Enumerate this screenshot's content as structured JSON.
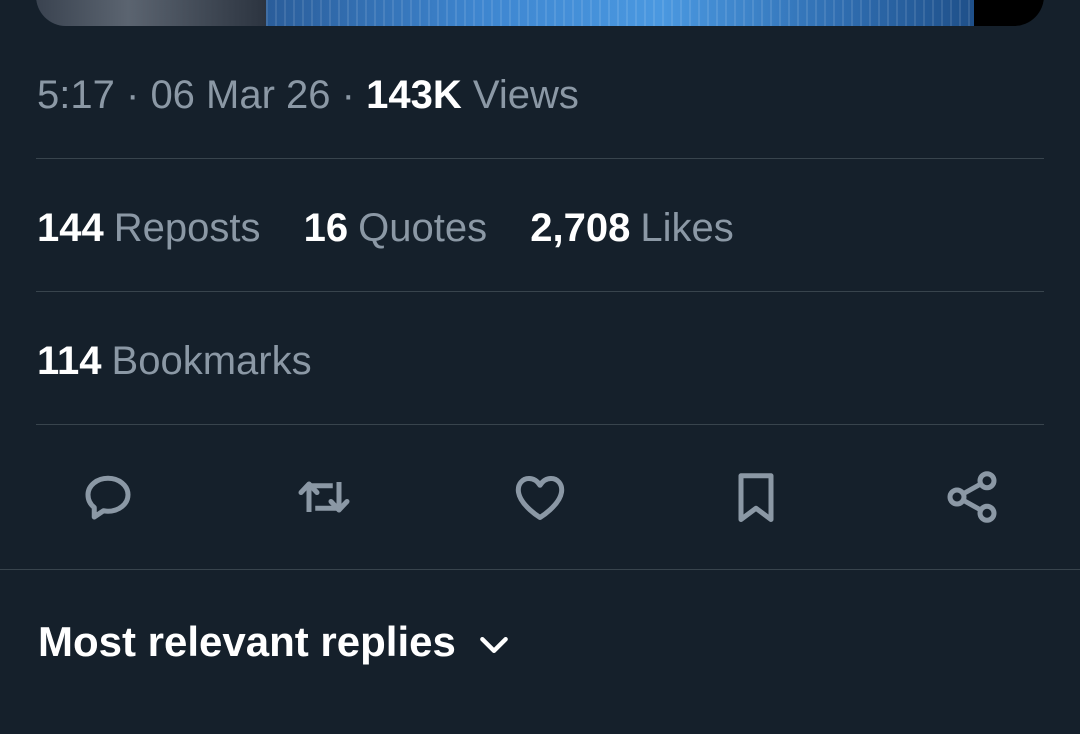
{
  "tweet_meta": {
    "time": "5:17",
    "separator": "·",
    "date": "06 Mar 26",
    "views_count": "143K",
    "views_label": "Views"
  },
  "engagement": {
    "reposts": {
      "count": "144",
      "label": "Reposts"
    },
    "quotes": {
      "count": "16",
      "label": "Quotes"
    },
    "likes": {
      "count": "2,708",
      "label": "Likes"
    },
    "bookmarks": {
      "count": "114",
      "label": "Bookmarks"
    }
  },
  "actions": [
    {
      "name": "reply",
      "icon": "reply-icon"
    },
    {
      "name": "repost",
      "icon": "repost-icon"
    },
    {
      "name": "like",
      "icon": "heart-icon"
    },
    {
      "name": "bookmark",
      "icon": "bookmark-icon"
    },
    {
      "name": "share",
      "icon": "share-icon"
    }
  ],
  "replies": {
    "sort_label": "Most relevant replies"
  },
  "colors": {
    "background": "#15202b",
    "secondary_text": "#8b98a5",
    "primary_text": "#ffffff",
    "divider": "#38444d",
    "icon": "#8b98a5"
  }
}
